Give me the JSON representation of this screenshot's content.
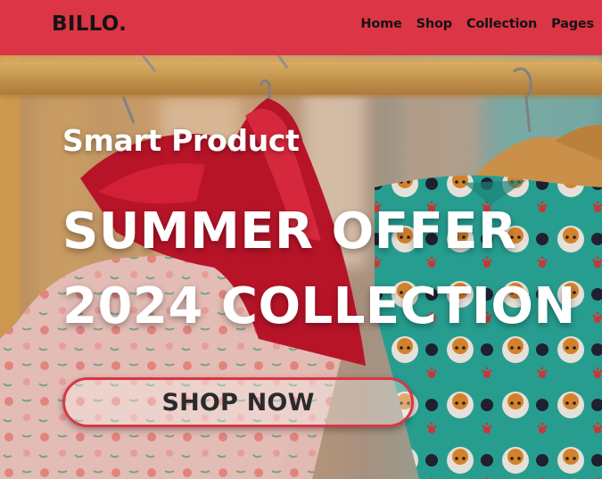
{
  "header": {
    "logo": "BILLO.",
    "nav": [
      {
        "label": "Home"
      },
      {
        "label": "Shop"
      },
      {
        "label": "Collection"
      },
      {
        "label": "Pages"
      }
    ]
  },
  "hero": {
    "subtitle": "Smart Product",
    "title_line1": "SUMMER OFFER",
    "title_line2": "2024 COLLECTION",
    "cta_label": "SHOP NOW",
    "background_image": "clothes-on-hangers-photo"
  },
  "colors": {
    "brand_red": "#dc3545",
    "nav_text": "#141414",
    "hero_text": "#ffffff"
  }
}
